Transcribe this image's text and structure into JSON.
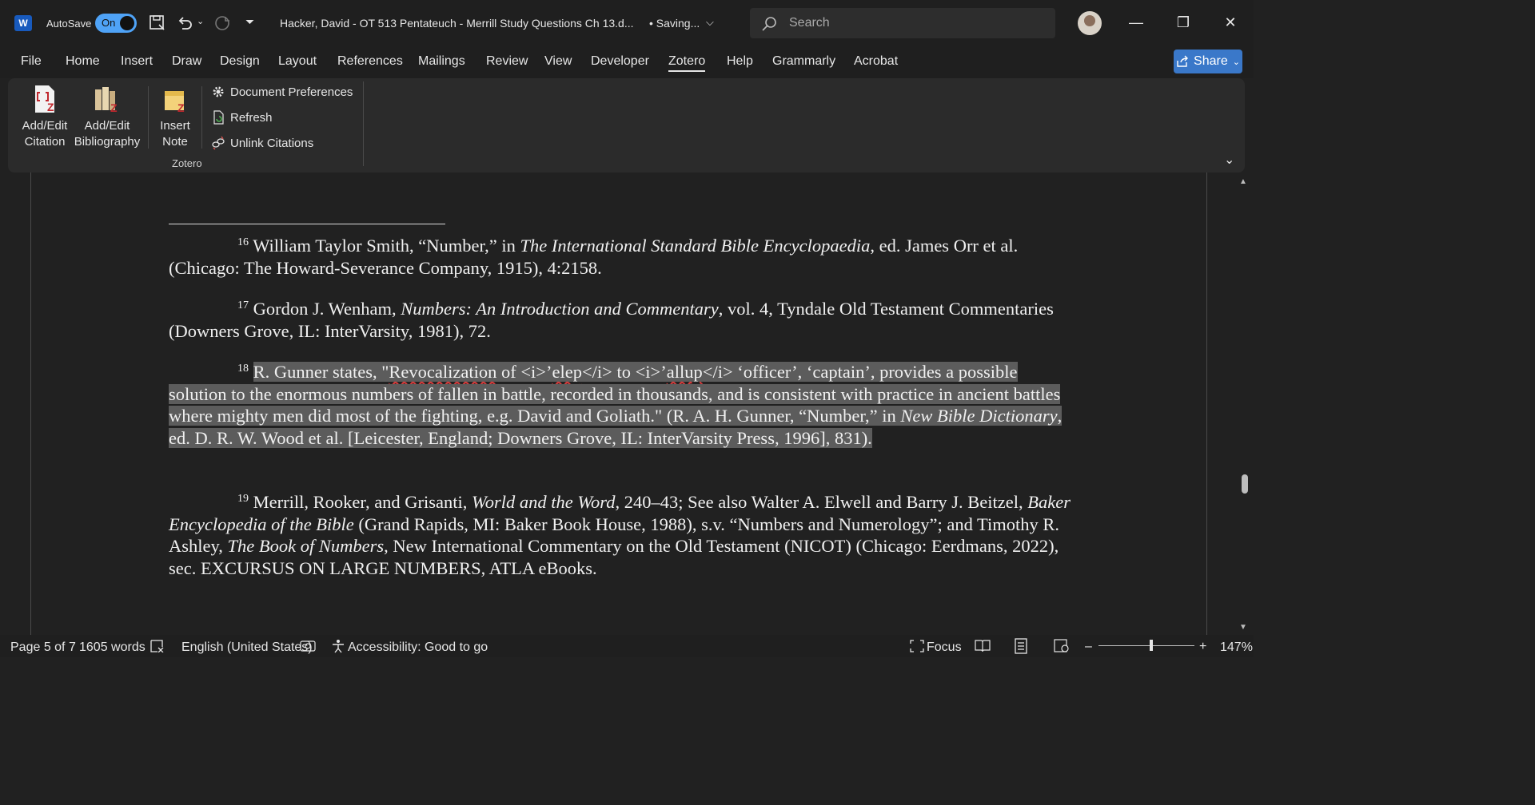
{
  "titlebar": {
    "app_icon": "word-icon",
    "autosave_label": "AutoSave",
    "autosave_state": "On",
    "document_title": "Hacker, David - OT 513 Pentateuch - Merrill Study Questions Ch 13.d...",
    "saving_status": "• Saving...",
    "search_placeholder": "Search"
  },
  "menu": {
    "tabs": [
      "File",
      "Home",
      "Insert",
      "Draw",
      "Design",
      "Layout",
      "References",
      "Mailings",
      "Review",
      "View",
      "Developer",
      "Zotero",
      "Help",
      "Grammarly",
      "Acrobat"
    ],
    "active_tab": "Zotero",
    "share_label": "Share"
  },
  "ribbon": {
    "add_edit_citation": [
      "Add/Edit",
      "Citation"
    ],
    "add_edit_bibliography": [
      "Add/Edit",
      "Bibliography"
    ],
    "insert_note": [
      "Insert",
      "Note"
    ],
    "document_preferences": "Document Preferences",
    "refresh": "Refresh",
    "unlink_citations": "Unlink Citations",
    "group_label": "Zotero"
  },
  "footnotes": [
    {
      "num": "16",
      "parts": [
        "William Taylor Smith, “Number,” in ",
        "The International Standard Bible Encyclopaedia",
        ", ed. James Orr et al. (Chicago: The Howard-Severance Company, 1915), 4:2158."
      ]
    },
    {
      "num": "17",
      "parts": [
        "Gordon J. Wenham, ",
        "Numbers: An Introduction and Commentary",
        ", vol. 4, Tyndale Old Testament Commentaries (Downers Grove, IL: InterVarsity, 1981), 72."
      ]
    },
    {
      "num": "18",
      "parts": [
        "R. Gunner states, \"",
        "Revocalization",
        " of <i>’",
        "elep",
        "</i> to <i>’",
        "allup",
        "</i> ‘officer’, ‘captain’, provides a possible solution to the enormous numbers of fallen in battle, recorded in thousands, and is consistent with practice in ancient battles where mighty men did most of the fighting, e.g. David and Goliath.\" (R. A. H. Gunner, “Number,” in ",
        "New Bible Dictionary",
        ", ed. D. R. W. Wood et al. [Leicester, England; Downers Grove, IL: InterVarsity Press, 1996], 831)."
      ]
    },
    {
      "num": "19",
      "parts": [
        "Merrill, Rooker, and Grisanti, ",
        "World and the Word",
        ", 240–43; See also Walter A. Elwell and Barry J. Beitzel, ",
        "Baker Encyclopedia of the Bible",
        " (Grand Rapids, MI: Baker Book House, 1988), s.v. “Numbers and Numerology”; and Timothy R. Ashley, ",
        "The Book of Numbers",
        ", New International Commentary on the Old Testament (NICOT) (Chicago: Eerdmans, 2022), sec. EXCURSUS ON LARGE NUMBERS, ATLA eBooks."
      ]
    }
  ],
  "status": {
    "page": "Page 5 of 7",
    "words": "1605 words",
    "language": "English (United States)",
    "accessibility": "Accessibility: Good to go",
    "focus": "Focus",
    "zoom_minus": "–",
    "zoom_plus": "+",
    "zoom": "147%",
    "zoom_level_percent": 147
  }
}
